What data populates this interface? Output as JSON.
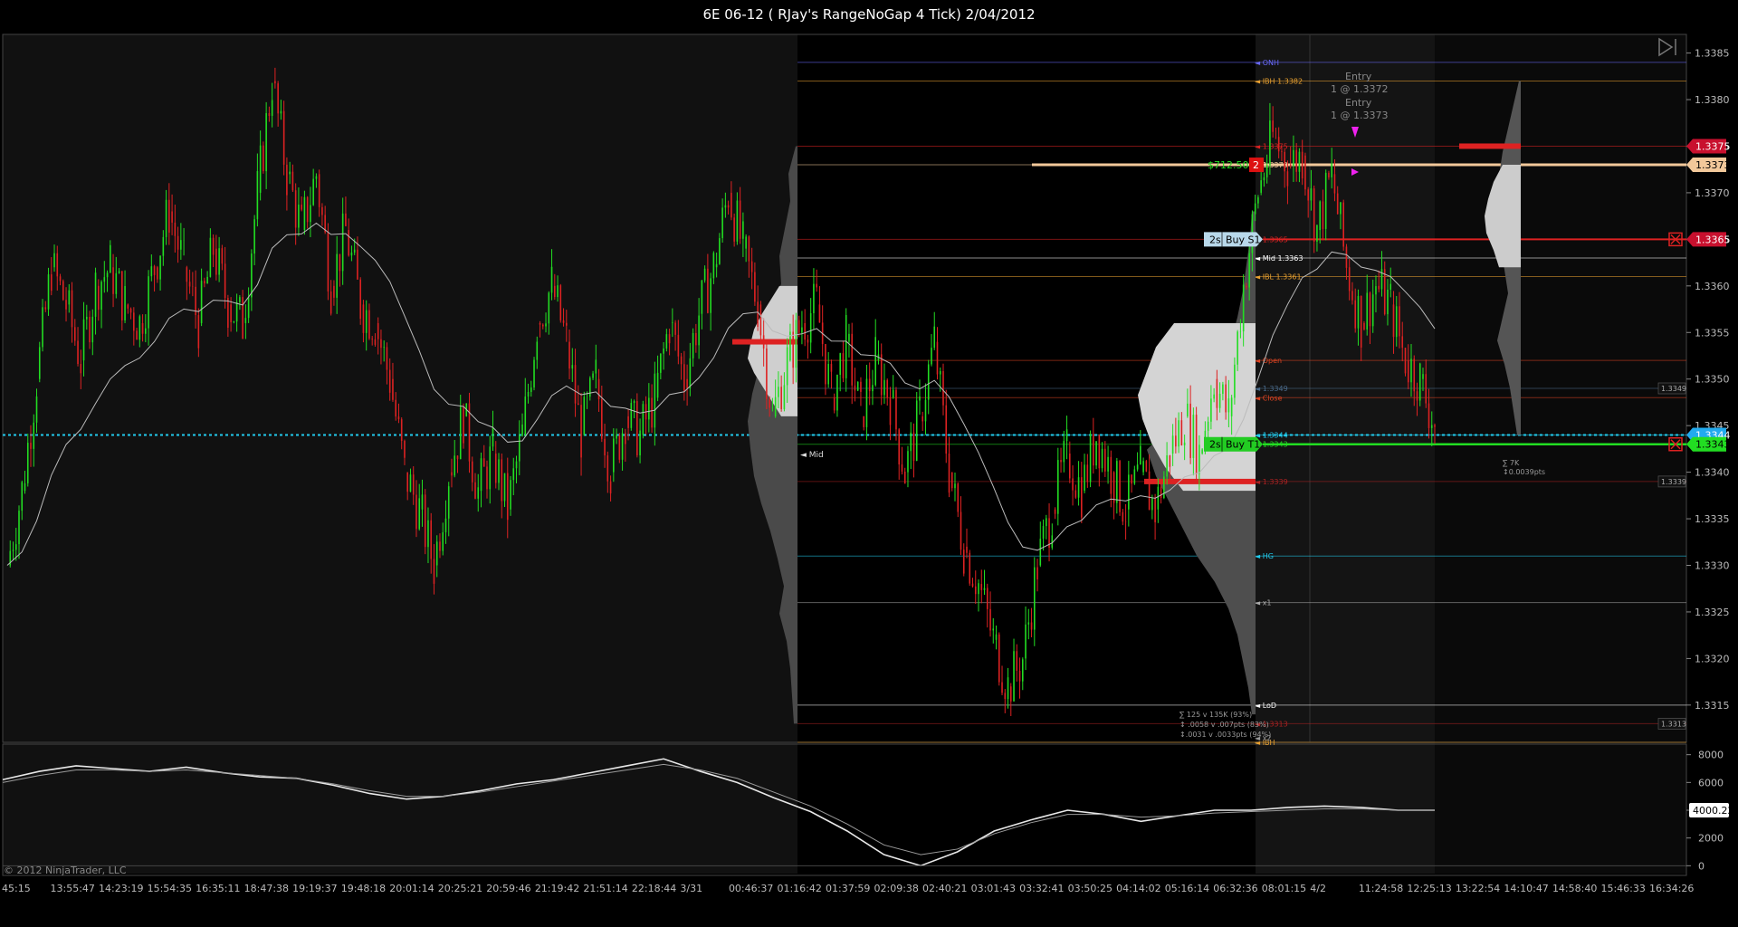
{
  "window": {
    "title": "6E 06-12 ( RJay's RangeNoGap  4 Tick)  2/04/2012"
  },
  "copyright": "© 2012 NinjaTrader, LLC",
  "colors": {
    "up": "#22dd22",
    "down": "#dd2222",
    "cyan": "#22ccee",
    "tan": "#f2c89a",
    "orange": "#e8a030"
  },
  "chart_data": [
    {
      "type": "candlestick",
      "title": "",
      "ylim": [
        1.3311,
        1.3387
      ],
      "y_ticks": [
        "1.3385",
        "1.3380",
        "1.3375",
        "1.3370",
        "1.3365",
        "1.3360",
        "1.3355",
        "1.3350",
        "1.3345",
        "1.3340",
        "1.3335",
        "1.3330",
        "1.3325",
        "1.3320",
        "1.3315"
      ],
      "x_ticks": [
        "45:15",
        "13:55:47",
        "14:23:19",
        "15:54:35",
        "16:35:11",
        "18:47:38",
        "19:19:37",
        "19:48:18",
        "20:01:14",
        "20:25:21",
        "20:59:46",
        "21:19:42",
        "21:51:14",
        "22:18:44",
        "3/31",
        "00:46:37",
        "01:16:42",
        "01:37:59",
        "02:09:38",
        "02:40:21",
        "03:01:43",
        "03:32:41",
        "03:50:25",
        "04:14:02",
        "05:16:14",
        "06:32:36",
        "08:01:15",
        "4/2",
        "11:24:58",
        "12:25:13",
        "13:22:54",
        "14:10:47",
        "14:58:40",
        "15:46:33",
        "16:34:26"
      ],
      "price_path": [
        [
          0,
          1.333
        ],
        [
          1,
          1.3338
        ],
        [
          2,
          1.335
        ],
        [
          3,
          1.3362
        ],
        [
          4,
          1.3358
        ],
        [
          5,
          1.3352
        ],
        [
          6,
          1.336
        ],
        [
          7,
          1.3362
        ],
        [
          8,
          1.3358
        ],
        [
          9,
          1.3356
        ],
        [
          10,
          1.3362
        ],
        [
          11,
          1.3368
        ],
        [
          12,
          1.3362
        ],
        [
          13,
          1.3356
        ],
        [
          14,
          1.3364
        ],
        [
          15,
          1.3358
        ],
        [
          16,
          1.3356
        ],
        [
          17,
          1.337
        ],
        [
          18,
          1.3382
        ],
        [
          19,
          1.3372
        ],
        [
          20,
          1.3366
        ],
        [
          21,
          1.3372
        ],
        [
          22,
          1.336
        ],
        [
          23,
          1.3366
        ],
        [
          24,
          1.3358
        ],
        [
          25,
          1.3356
        ],
        [
          26,
          1.335
        ],
        [
          27,
          1.334
        ],
        [
          28,
          1.3336
        ],
        [
          29,
          1.333
        ],
        [
          30,
          1.334
        ],
        [
          31,
          1.3346
        ],
        [
          32,
          1.3338
        ],
        [
          33,
          1.3342
        ],
        [
          34,
          1.3336
        ],
        [
          35,
          1.3344
        ],
        [
          36,
          1.3356
        ],
        [
          37,
          1.336
        ],
        [
          38,
          1.3354
        ],
        [
          39,
          1.3344
        ],
        [
          40,
          1.335
        ],
        [
          41,
          1.334
        ],
        [
          42,
          1.3346
        ],
        [
          43,
          1.3344
        ],
        [
          44,
          1.3348
        ],
        [
          45,
          1.3356
        ],
        [
          46,
          1.335
        ],
        [
          47,
          1.3357
        ],
        [
          48,
          1.3362
        ],
        [
          49,
          1.337
        ],
        [
          50,
          1.3364
        ],
        [
          51,
          1.3358
        ],
        [
          52,
          1.3346
        ],
        [
          53,
          1.3352
        ],
        [
          54,
          1.3356
        ],
        [
          55,
          1.3358
        ],
        [
          56,
          1.3348
        ],
        [
          57,
          1.3354
        ],
        [
          58,
          1.3346
        ],
        [
          59,
          1.3352
        ],
        [
          60,
          1.3348
        ],
        [
          61,
          1.334
        ],
        [
          62,
          1.3346
        ],
        [
          63,
          1.3354
        ],
        [
          64,
          1.334
        ],
        [
          65,
          1.3332
        ],
        [
          66,
          1.3328
        ],
        [
          67,
          1.3322
        ],
        [
          68,
          1.3317
        ],
        [
          69,
          1.332
        ],
        [
          70,
          1.333
        ],
        [
          71,
          1.3336
        ],
        [
          72,
          1.3342
        ],
        [
          73,
          1.3338
        ],
        [
          74,
          1.3344
        ],
        [
          75,
          1.334
        ],
        [
          76,
          1.3336
        ],
        [
          77,
          1.334
        ],
        [
          78,
          1.3336
        ],
        [
          79,
          1.3342
        ],
        [
          80,
          1.3346
        ],
        [
          81,
          1.3342
        ],
        [
          82,
          1.335
        ],
        [
          83,
          1.3346
        ],
        [
          84,
          1.336
        ],
        [
          85,
          1.337
        ],
        [
          86,
          1.3376
        ],
        [
          87,
          1.3373
        ],
        [
          88,
          1.3374
        ],
        [
          89,
          1.3366
        ],
        [
          90,
          1.3372
        ],
        [
          91,
          1.3362
        ],
        [
          92,
          1.3356
        ],
        [
          93,
          1.336
        ],
        [
          94,
          1.3358
        ],
        [
          95,
          1.3352
        ],
        [
          96,
          1.335
        ],
        [
          97,
          1.3345
        ]
      ],
      "levels": [
        {
          "label": "ONH",
          "value": 1.3384,
          "color": "#6a6aff"
        },
        {
          "label": "IBH 1.3382",
          "value": 1.3382,
          "color": "#e8a030"
        },
        {
          "label": "1.3375",
          "value": 1.3375,
          "color": "#dd2222"
        },
        {
          "label": "1.3373",
          "value": 1.3373,
          "color": "#f2c89a"
        },
        {
          "label": "1.3365",
          "value": 1.3365,
          "color": "#dd2222"
        },
        {
          "label": "Mid 1.3363",
          "value": 1.3363,
          "color": "#ffffff"
        },
        {
          "label": "IBL 1.3361",
          "value": 1.3361,
          "color": "#e8a030"
        },
        {
          "label": "Open",
          "value": 1.3352,
          "color": "#dd4422"
        },
        {
          "label": "Close",
          "value": 1.3348,
          "color": "#dd4422"
        },
        {
          "label": "1.3349",
          "value": 1.3349,
          "color": "#4a6a8a"
        },
        {
          "label": "1.3344",
          "value": 1.3344,
          "color": "#22ccee"
        },
        {
          "label": "1.3343",
          "value": 1.3343,
          "color": "#22dd22"
        },
        {
          "label": "1.3339",
          "value": 1.3339,
          "color": "#aa2222"
        },
        {
          "label": "HG",
          "value": 1.3331,
          "color": "#22ccee"
        },
        {
          "label": "x1",
          "value": 1.3326,
          "color": "#aaaaaa"
        },
        {
          "label": "LoD",
          "value": 1.3315,
          "color": "#ffffff"
        },
        {
          "label": "1.3313",
          "value": 1.3313,
          "color": "#aa2222"
        },
        {
          "label": "IBH",
          "value": 1.3311,
          "color": "#e8a030"
        }
      ],
      "price_labels": [
        {
          "text": "1.3375",
          "value": 1.3375,
          "bg": "#c8102e",
          "fg": "#ffffff"
        },
        {
          "text": "1.3373",
          "value": 1.3373,
          "bg": "#f2c89a",
          "fg": "#000000"
        },
        {
          "text": "1.3365",
          "value": 1.3365,
          "bg": "#c8102e",
          "fg": "#ffffff"
        },
        {
          "text": "1.3344",
          "value": 1.3344,
          "bg": "#22aaee",
          "fg": "#ffffff"
        },
        {
          "text": "1.3343",
          "value": 1.3343,
          "bg": "#22dd22",
          "fg": "#000000"
        }
      ],
      "annotations": {
        "pnl": "$712.50",
        "position_qty": "2",
        "order_sell": {
          "qty": "2s",
          "label": "Buy S1",
          "value": 1.3365
        },
        "order_target": {
          "qty": "2s",
          "label": "Buy T1",
          "value": 1.3343
        },
        "entries": [
          [
            "Entry",
            "1 @ 1.3372"
          ],
          [
            "Entry",
            "1 @ 1.3373"
          ]
        ],
        "mid_label": "Mid",
        "open_label": "Open",
        "close_label": "Close",
        "stats_a": [
          "∑ 125 v 135K (93%)",
          "↕ .0058 v .007pts (83%)",
          "↕.0031 v .0033pts (94%)"
        ],
        "x2_label": "x2",
        "stats_b": [
          "∑ 7K",
          "↕0.0039pts"
        ],
        "small_labels": [
          "1.3349",
          "1.3339",
          "1.3313"
        ]
      }
    },
    {
      "type": "line",
      "title": "",
      "ylim": [
        -500,
        8500
      ],
      "y_ticks": [
        "8000",
        "6000",
        "4000",
        "2000",
        "0"
      ],
      "last_value": "4000.22",
      "series": [
        {
          "values": [
            6200,
            6800,
            7200,
            7000,
            6800,
            7100,
            6700,
            6400,
            6300,
            5800,
            5200,
            4800,
            5000,
            5400,
            5900,
            6200,
            6700,
            7200,
            7700,
            6800,
            6000,
            4900,
            3900,
            2500,
            800,
            0,
            1000,
            2500,
            3300,
            4000,
            3700,
            3200,
            3600,
            4000,
            4000,
            4200,
            4300,
            4200,
            4000,
            4000
          ]
        },
        {
          "values": [
            6000,
            6500,
            6900,
            6900,
            6800,
            6900,
            6700,
            6500,
            6300,
            5900,
            5400,
            5000,
            5000,
            5300,
            5700,
            6100,
            6500,
            6900,
            7300,
            6900,
            6300,
            5300,
            4300,
            3000,
            1500,
            800,
            1200,
            2300,
            3100,
            3700,
            3700,
            3500,
            3600,
            3800,
            3900,
            4000,
            4100,
            4100,
            4000,
            4000
          ]
        }
      ]
    }
  ]
}
